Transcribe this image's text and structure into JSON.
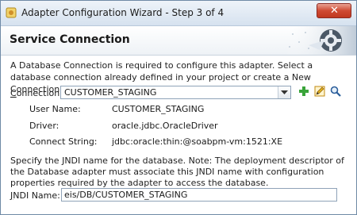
{
  "window": {
    "title": "Adapter Configuration Wizard - Step 3 of 4",
    "close_glyph": "✕"
  },
  "header": {
    "title": "Service Connection"
  },
  "description": "A Database Connection is required to configure this adapter. Select a database connection already defined in your project or create a New Connection.",
  "connection": {
    "label_mnemonic": "C",
    "label_rest": "onnection:",
    "selected": "CUSTOMER_STAGING",
    "icons": [
      "add-icon",
      "edit-pencil-icon",
      "search-magnifier-icon"
    ]
  },
  "details": {
    "user_name_label": "User Name:",
    "user_name_value": "CUSTOMER_STAGING",
    "driver_label": "Driver:",
    "driver_value": "oracle.jdbc.OracleDriver",
    "connect_string_label": "Connect String:",
    "connect_string_value": "jdbc:oracle:thin:@soabpm-vm:1521:XE"
  },
  "jndi": {
    "description": "Specify the JNDI name for the database.  Note: The deployment descriptor of the Database adapter must associate this JNDI name with configuration properties required by the adapter to access the database.",
    "label_mnemonic": "J",
    "label_rest": "NDI Name:",
    "value": "eis/DB/CUSTOMER_STAGING"
  },
  "colors": {
    "title_bar": "#d6e2ef",
    "close_button": "#cf4a33",
    "add_icon": "#3aa43a",
    "edit_icon": "#e0b020"
  }
}
